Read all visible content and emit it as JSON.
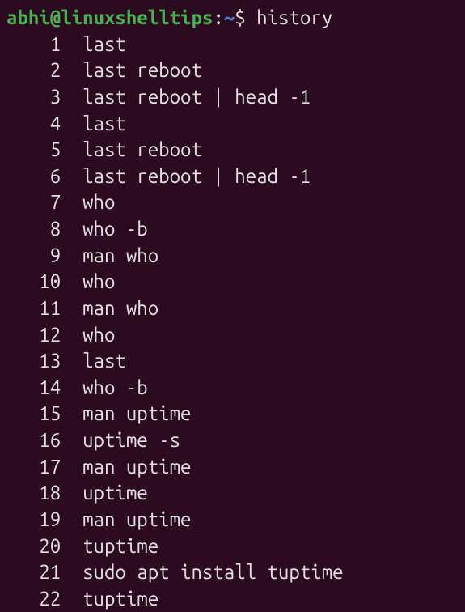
{
  "prompt": {
    "user_host": "abhi@linuxshelltips",
    "colon": ":",
    "path": "~",
    "dollar": "$",
    "command": "history"
  },
  "history": [
    {
      "num": "1",
      "cmd": "last"
    },
    {
      "num": "2",
      "cmd": "last reboot"
    },
    {
      "num": "3",
      "cmd": "last reboot | head -1"
    },
    {
      "num": "4",
      "cmd": "last"
    },
    {
      "num": "5",
      "cmd": "last reboot"
    },
    {
      "num": "6",
      "cmd": "last reboot | head -1"
    },
    {
      "num": "7",
      "cmd": "who"
    },
    {
      "num": "8",
      "cmd": "who -b"
    },
    {
      "num": "9",
      "cmd": "man who"
    },
    {
      "num": "10",
      "cmd": "who"
    },
    {
      "num": "11",
      "cmd": "man who"
    },
    {
      "num": "12",
      "cmd": "who"
    },
    {
      "num": "13",
      "cmd": "last"
    },
    {
      "num": "14",
      "cmd": "who -b"
    },
    {
      "num": "15",
      "cmd": "man uptime"
    },
    {
      "num": "16",
      "cmd": "uptime -s"
    },
    {
      "num": "17",
      "cmd": "man uptime"
    },
    {
      "num": "18",
      "cmd": "uptime"
    },
    {
      "num": "19",
      "cmd": "man uptime"
    },
    {
      "num": "20",
      "cmd": "tuptime"
    },
    {
      "num": "21",
      "cmd": "sudo apt install tuptime"
    },
    {
      "num": "22",
      "cmd": "tuptime"
    }
  ]
}
